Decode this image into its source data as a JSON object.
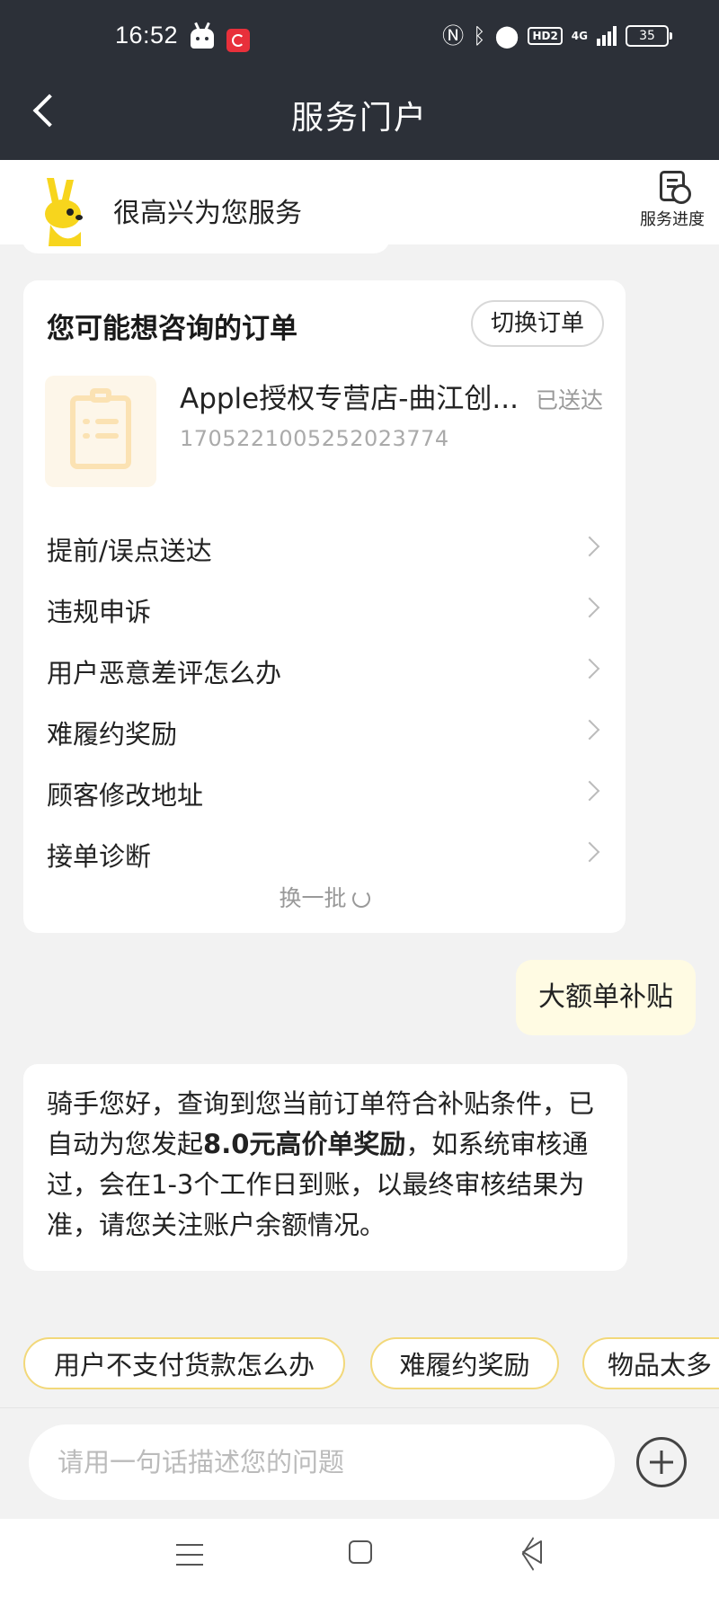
{
  "status_bar": {
    "time": "16:52",
    "battery": "35",
    "icons": [
      "nfc-icon",
      "bluetooth-icon",
      "location-icon",
      "hd-icon",
      "signal-icon",
      "battery-icon"
    ],
    "hd_label": "HD2",
    "network_label": "4G"
  },
  "header": {
    "title": "服务门户"
  },
  "greeting": {
    "text": "很高兴为您服务",
    "progress_label": "服务进度"
  },
  "order_card": {
    "title": "您可能想咨询的订单",
    "switch_label": "切换订单",
    "order": {
      "name": "Apple授权专营店-曲江创...",
      "status": "已送达",
      "id": "1705221005252023774"
    },
    "faq": [
      {
        "label": "提前/误点送达"
      },
      {
        "label": "违规申诉"
      },
      {
        "label": "用户恶意差评怎么办"
      },
      {
        "label": "难履约奖励"
      },
      {
        "label": "顾客修改地址"
      },
      {
        "label": "接单诊断"
      }
    ],
    "refresh_label": "换一批"
  },
  "user_message": "大额单补贴",
  "reply": {
    "part1": "骑手您好，查询到您当前订单符合补贴条件，已自动为您发起",
    "bold": "8.0元高价单奖励",
    "part2": "，如系统审核通过，会在1-3个工作日到账，以最终审核结果为准，请您关注账户余额情况。"
  },
  "chips": [
    {
      "label": "用户不支付货款怎么办"
    },
    {
      "label": "难履约奖励"
    },
    {
      "label": "物品太多"
    }
  ],
  "input": {
    "placeholder": "请用一句话描述您的问题"
  },
  "colors": {
    "header_bg": "#2c3038",
    "user_bubble": "#fffbe3",
    "chip_border": "#f2d87a",
    "mascot": "#f7d51d"
  }
}
